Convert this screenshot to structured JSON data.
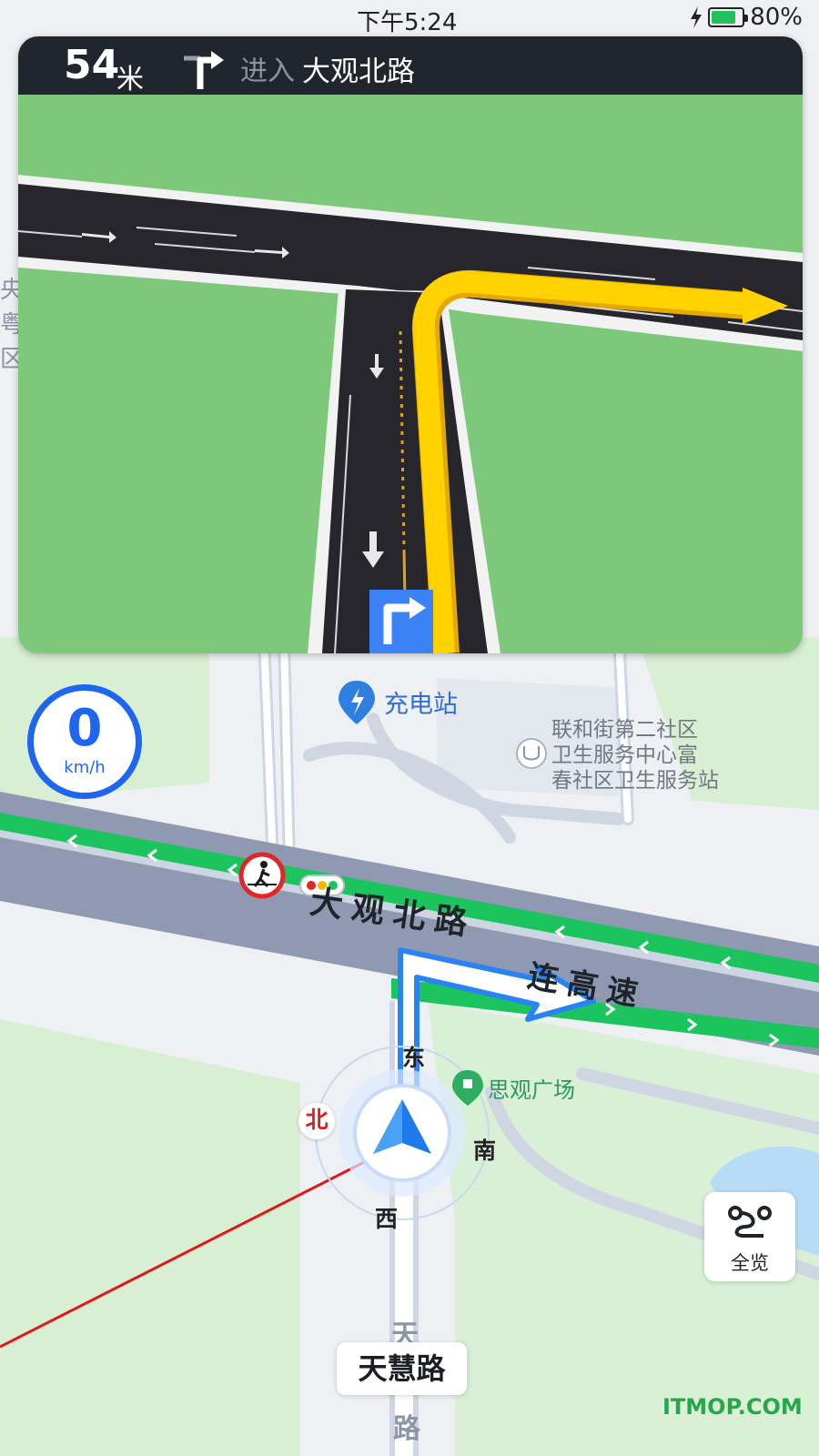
{
  "status_bar": {
    "time": "下午5:24",
    "battery_percent": "80%",
    "battery_level": 0.8,
    "charging": true
  },
  "guidance": {
    "distance_value": "54",
    "distance_unit": "米",
    "turn_icon": "turn-right-icon",
    "action": "进入",
    "road_name": "大观北路"
  },
  "speed": {
    "value": "0",
    "unit": "km/h"
  },
  "map": {
    "pois": {
      "charging_station": "充电站",
      "clinic_lines": [
        "联和街第二社区",
        "卫生服务中心富",
        "春社区卫生服务站"
      ],
      "plaza": "思观广场"
    },
    "road_labels": {
      "main_road": "大观北路",
      "expressway": "连高速",
      "side_street_top": "天",
      "side_street_bottom": "路"
    },
    "left_edge_labels": [
      "央",
      "粤",
      "区"
    ],
    "colors": {
      "route_green": "#1bc45c",
      "guide_blue": "#2a83f2",
      "turn_yellow": "#ffd200",
      "grass": "#7dc87a",
      "pink_line": "#e01818"
    }
  },
  "compass": {
    "east": "东",
    "south": "南",
    "west": "西",
    "north": "北"
  },
  "overview_button": {
    "label": "全览",
    "icon": "route-overview-icon"
  },
  "current_road": "天慧路",
  "watermark": "ITMOP.COM"
}
